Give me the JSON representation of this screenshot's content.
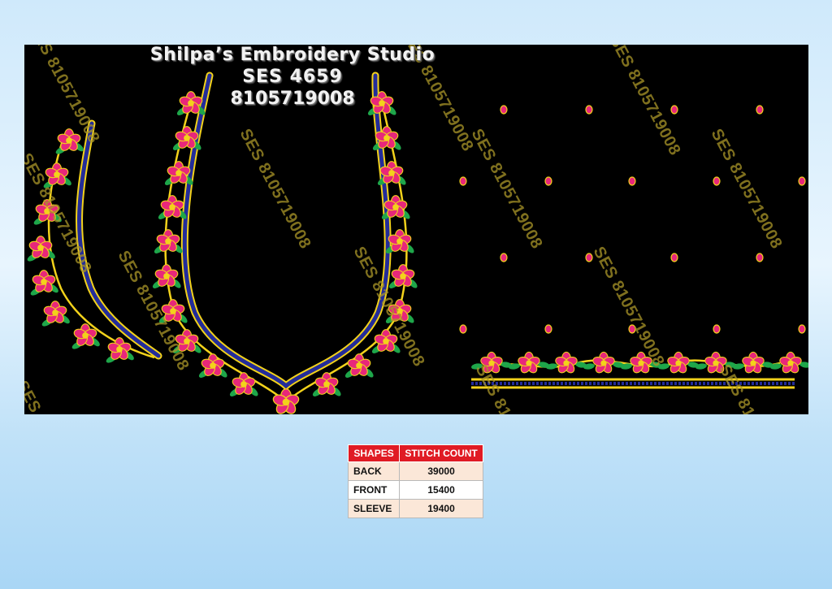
{
  "header": {
    "studio_name": "Shilpa’s Embroidery Studio",
    "design_code": "SES 4659",
    "phone": "8105719008"
  },
  "watermark": {
    "text": "SES 8105719008"
  },
  "table": {
    "headers": [
      "SHAPES",
      "STITCH COUNT"
    ],
    "rows": [
      {
        "shape": "BACK",
        "count": "39000"
      },
      {
        "shape": "FRONT",
        "count": "15400"
      },
      {
        "shape": "SLEEVE",
        "count": "19400"
      }
    ]
  },
  "colors": {
    "background": "#000000",
    "flower": "#e8277a",
    "leaf": "#1ea64a",
    "gold": "#f2d21b",
    "blue": "#232c9a",
    "table_header": "#e01b24"
  }
}
